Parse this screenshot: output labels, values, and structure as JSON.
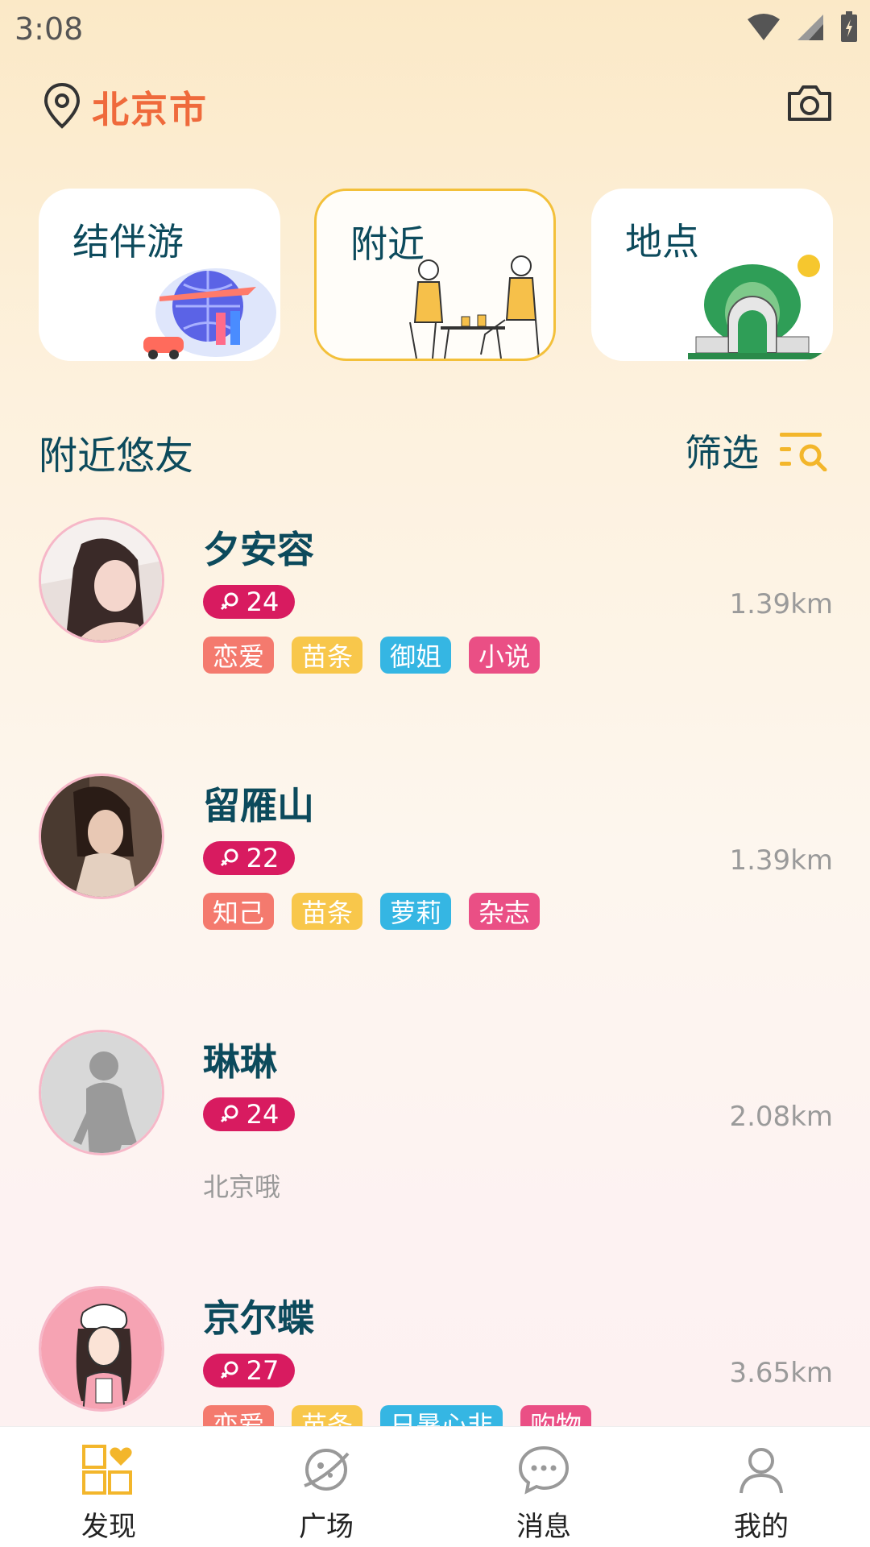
{
  "status_bar": {
    "time": "3:08"
  },
  "header": {
    "city": "北京市"
  },
  "categories": [
    {
      "label": "结伴游",
      "active": false
    },
    {
      "label": "附近",
      "active": true
    },
    {
      "label": "地点",
      "active": false
    }
  ],
  "section": {
    "title": "附近悠友",
    "filter_label": "筛选"
  },
  "users": [
    {
      "name": "夕安容",
      "age": "24",
      "distance": "1.39km",
      "tags": [
        "恋爱",
        "苗条",
        "御姐",
        "小说"
      ],
      "bio": ""
    },
    {
      "name": "留雁山",
      "age": "22",
      "distance": "1.39km",
      "tags": [
        "知己",
        "苗条",
        "萝莉",
        "杂志"
      ],
      "bio": ""
    },
    {
      "name": "琳琳",
      "age": "24",
      "distance": "2.08km",
      "tags": [],
      "bio": "北京哦"
    },
    {
      "name": "京尔蝶",
      "age": "27",
      "distance": "3.65km",
      "tags": [
        "恋爱",
        "苗条",
        "日暑心非",
        "购物"
      ],
      "bio": ""
    }
  ],
  "bottom_nav": [
    {
      "label": "发现",
      "icon": "discover-icon",
      "active": true
    },
    {
      "label": "广场",
      "icon": "planet-icon",
      "active": false
    },
    {
      "label": "消息",
      "icon": "chat-icon",
      "active": false
    },
    {
      "label": "我的",
      "icon": "profile-icon",
      "active": false
    }
  ],
  "colors": {
    "accent": "#ef6a3c",
    "primary_text": "#0c4a5c",
    "age_badge": "#d81b60",
    "active_border": "#f3c03a"
  }
}
